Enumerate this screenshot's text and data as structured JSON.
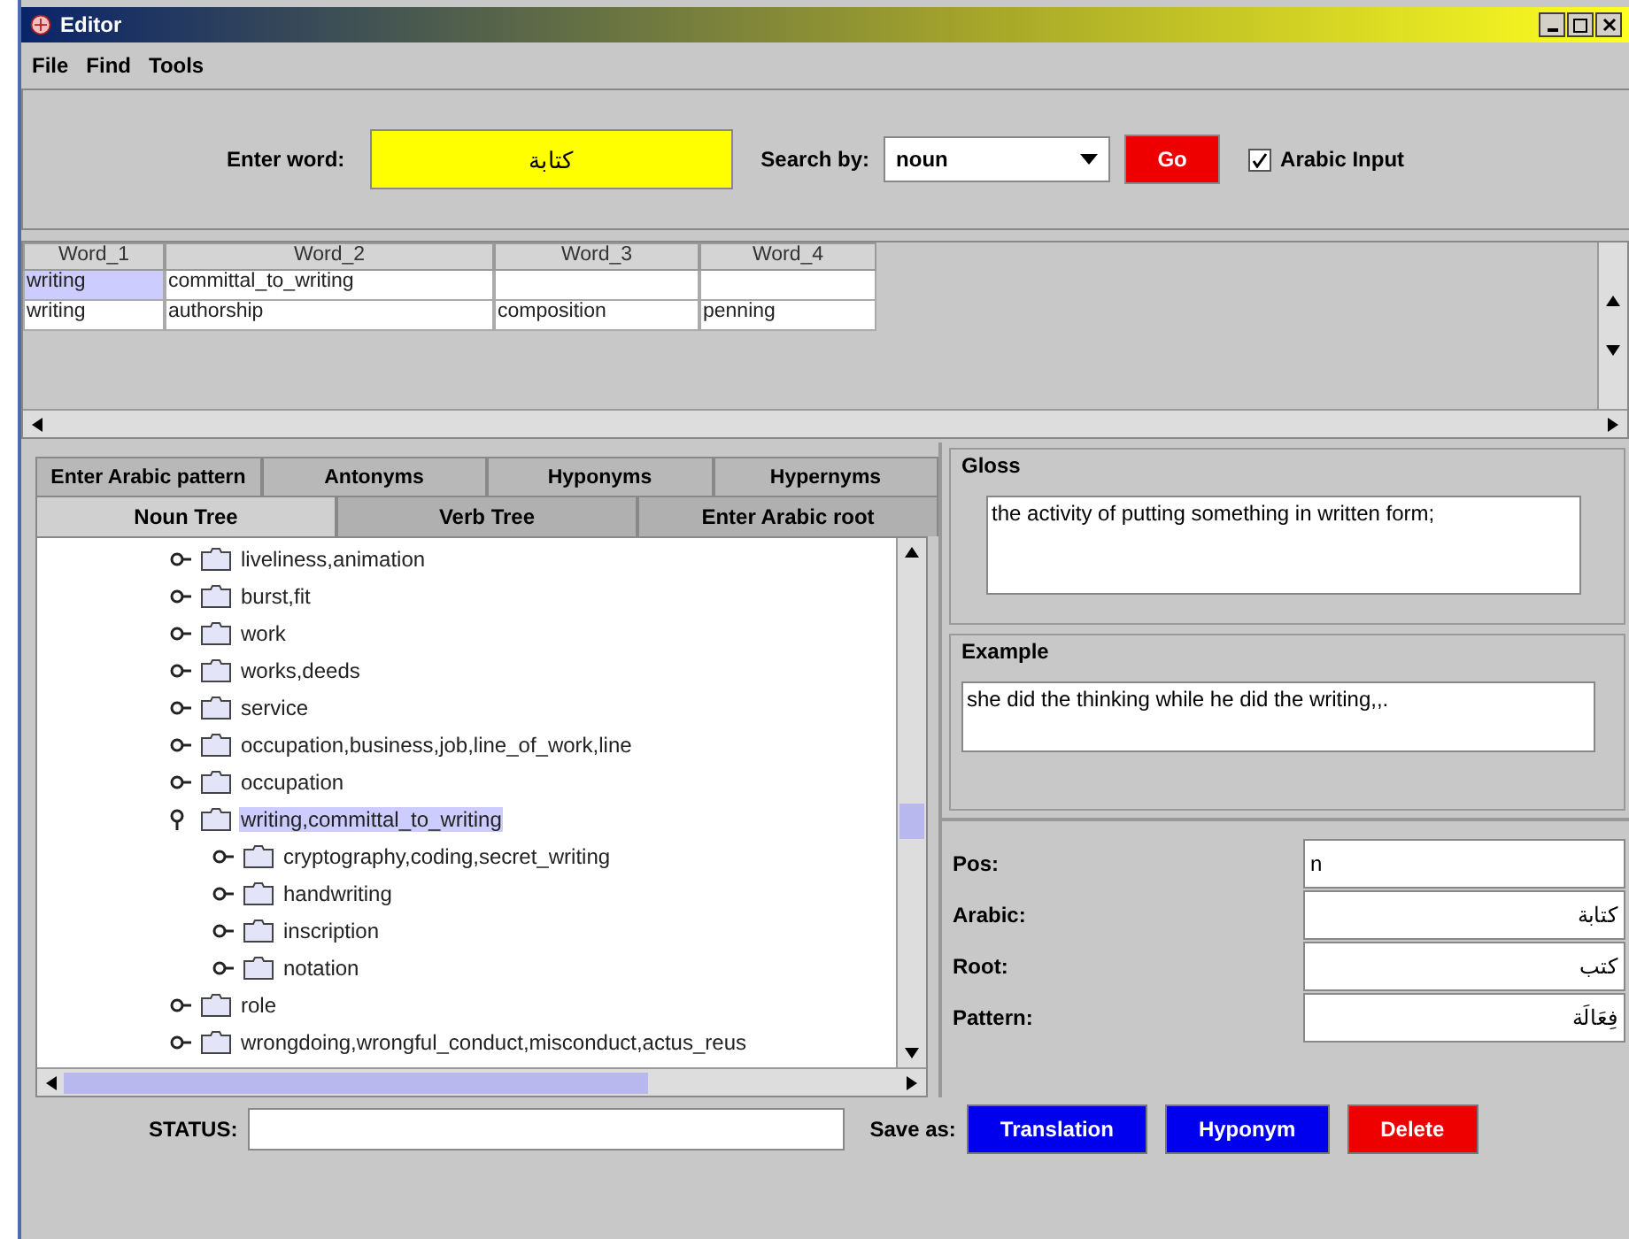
{
  "window": {
    "title": "Editor"
  },
  "menu": [
    "File",
    "Find",
    "Tools"
  ],
  "search": {
    "label": "Enter word:",
    "value": "كتابة",
    "by_label": "Search by:",
    "by_value": "noun",
    "go": "Go",
    "arabic_input": {
      "label": "Arabic Input",
      "checked": true
    }
  },
  "table": {
    "columns": [
      "Word_1",
      "Word_2",
      "Word_3",
      "Word_4"
    ],
    "rows": [
      {
        "cells": [
          {
            "text": "writing",
            "selected": true
          },
          {
            "text": "committal_to_writing",
            "selected": false
          },
          {
            "text": "",
            "selected": false
          },
          {
            "text": "",
            "selected": false
          }
        ]
      },
      {
        "cells": [
          {
            "text": "writing",
            "selected": false
          },
          {
            "text": "authorship",
            "selected": false
          },
          {
            "text": "composition",
            "selected": false
          },
          {
            "text": "penning",
            "selected": false
          }
        ]
      }
    ]
  },
  "tabs_back": [
    {
      "label": "Enter Arabic pattern"
    },
    {
      "label": "Antonyms"
    },
    {
      "label": "Hyponyms"
    },
    {
      "label": "Hypernyms"
    }
  ],
  "tabs": [
    {
      "label": "Noun Tree",
      "selected": true
    },
    {
      "label": "Verb Tree",
      "selected": false
    },
    {
      "label": "Enter Arabic root",
      "selected": false
    }
  ],
  "tree": [
    {
      "label": "liveliness,animation",
      "expanded": false,
      "selected": false
    },
    {
      "label": "burst,fit",
      "expanded": false,
      "selected": false
    },
    {
      "label": "work",
      "expanded": false,
      "selected": false
    },
    {
      "label": "works,deeds",
      "expanded": false,
      "selected": false
    },
    {
      "label": "service",
      "expanded": false,
      "selected": false
    },
    {
      "label": "occupation,business,job,line_of_work,line",
      "expanded": false,
      "selected": false
    },
    {
      "label": "occupation",
      "expanded": false,
      "selected": false
    },
    {
      "label": "writing,committal_to_writing",
      "expanded": true,
      "selected": true,
      "children": [
        {
          "label": "cryptography,coding,secret_writing",
          "expanded": false,
          "selected": false
        },
        {
          "label": "handwriting",
          "expanded": false,
          "selected": false
        },
        {
          "label": "inscription",
          "expanded": false,
          "selected": false
        },
        {
          "label": "notation",
          "expanded": false,
          "selected": false
        }
      ]
    },
    {
      "label": "role",
      "expanded": false,
      "selected": false
    },
    {
      "label": "wrongdoing,wrongful_conduct,misconduct,actus_reus",
      "expanded": false,
      "selected": false
    }
  ],
  "gloss": {
    "title": "Gloss",
    "text": "the activity of putting something in written form;"
  },
  "example": {
    "title": "Example",
    "text": "she did the thinking while he did the writing,,."
  },
  "fields": [
    {
      "label": "Pos:",
      "value": "n",
      "rtl": false
    },
    {
      "label": "Arabic:",
      "value": "كتابة",
      "rtl": true
    },
    {
      "label": "Root:",
      "value": "كتب",
      "rtl": true
    },
    {
      "label": "Pattern:",
      "value": "فِعَالَة",
      "rtl": true
    }
  ],
  "status": {
    "label": "STATUS:",
    "save_label": "Save as:",
    "buttons": [
      {
        "label": "Translation",
        "color": "#0000ee"
      },
      {
        "label": "Hyponym",
        "color": "#0000ee"
      },
      {
        "label": "Delete",
        "color": "#ee0000"
      }
    ]
  }
}
